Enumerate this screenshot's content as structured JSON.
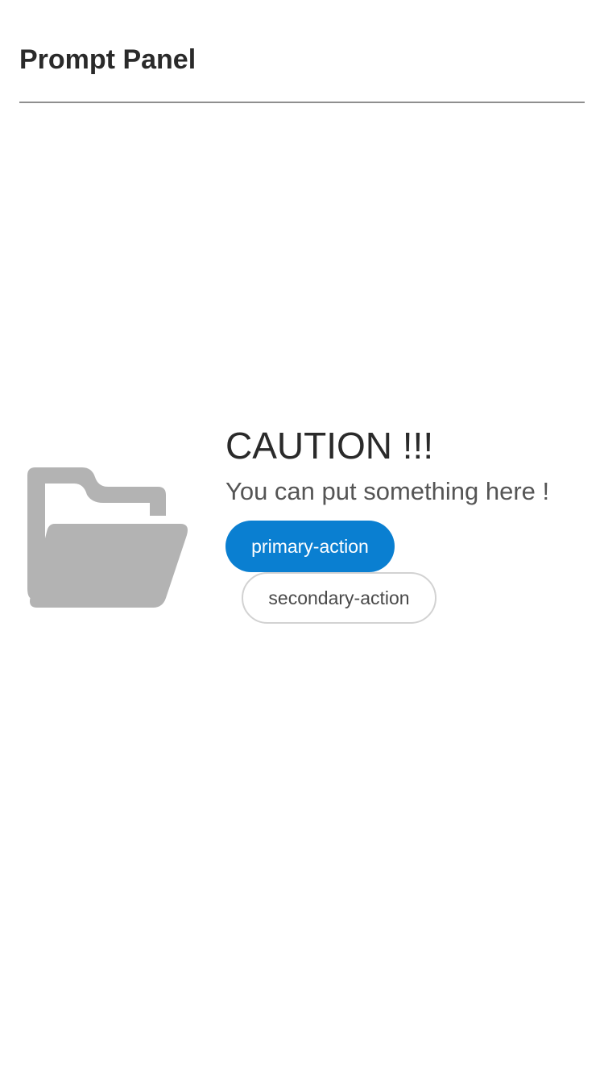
{
  "header": {
    "title": "Prompt Panel"
  },
  "prompt": {
    "icon": "folder-open-icon",
    "icon_color": "#b3b3b3",
    "heading": "CAUTION !!!",
    "message": "You can put something here !",
    "primary_action": "primary-action",
    "secondary_action": "secondary-action"
  },
  "colors": {
    "primary": "#0a7fd1",
    "divider": "#8f8f8f",
    "secondary_border": "#d2d2d2"
  }
}
